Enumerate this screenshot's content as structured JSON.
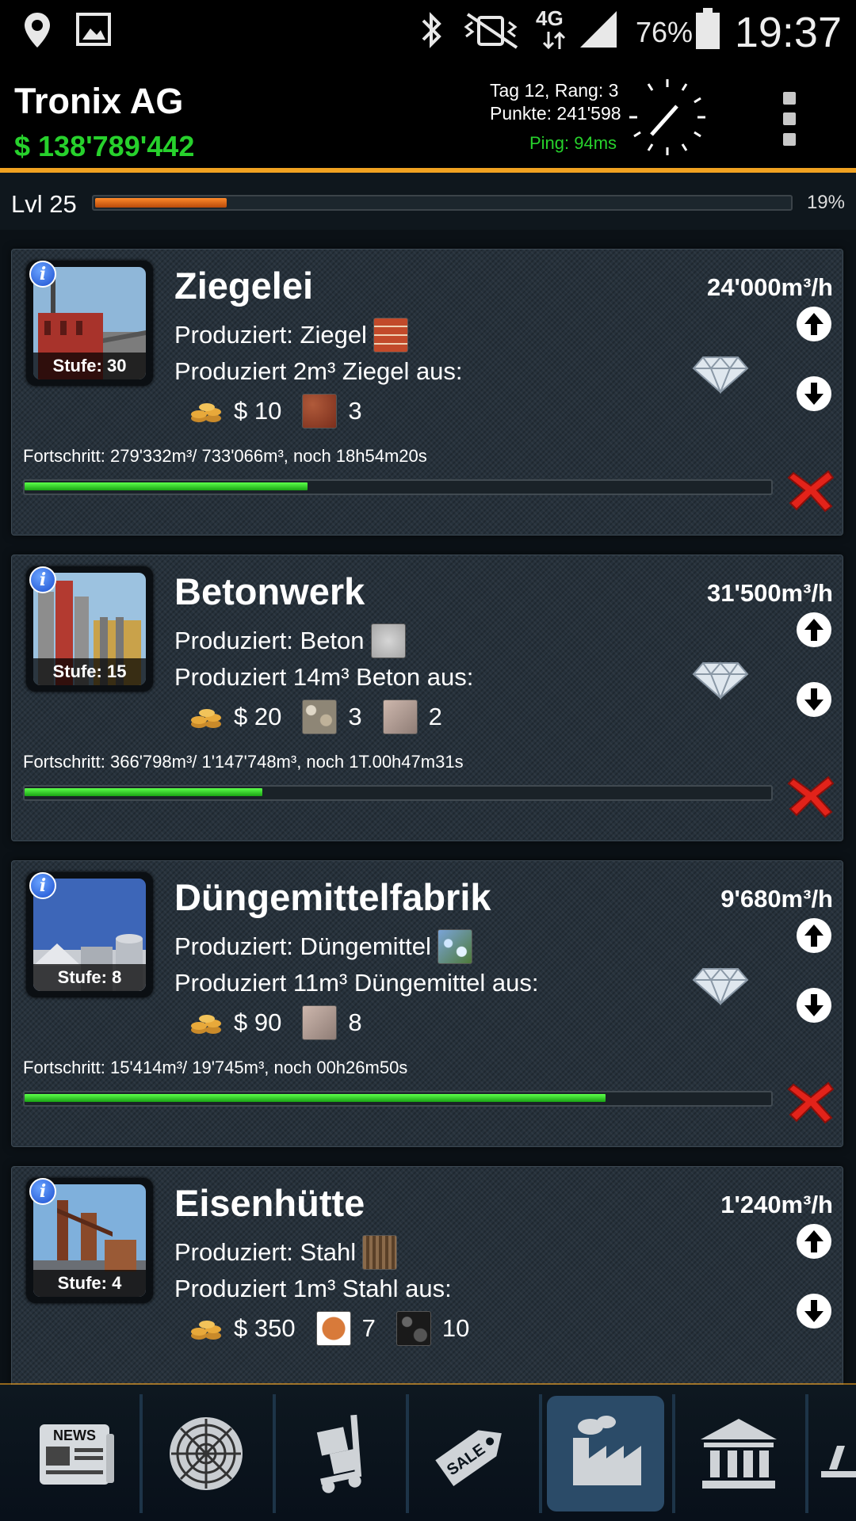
{
  "status_bar": {
    "network": "4G",
    "battery": "76%",
    "time": "19:37"
  },
  "header": {
    "company": "Tronix AG",
    "money": "$ 138'789'442",
    "day_rank": "Tag 12, Rang: 3",
    "points": "Punkte: 241'598",
    "ping": "Ping: 94ms"
  },
  "level": {
    "label": "Lvl 25",
    "percent_label": "19%",
    "fraction": 0.19
  },
  "factories": [
    {
      "name": "Ziegelei",
      "rate": "24'000m³/h",
      "stufe": "Stufe: 30",
      "produces": "Produziert: Ziegel",
      "recipe": "Produziert 2m³ Ziegel aus:",
      "cost": "$ 10",
      "inputs": [
        {
          "icon": "clay-icon",
          "qty": "3"
        }
      ],
      "progress_text": "Fortschritt: 279'332m³/ 733'066m³, noch 18h54m20s",
      "progress": 0.381
    },
    {
      "name": "Betonwerk",
      "rate": "31'500m³/h",
      "stufe": "Stufe: 15",
      "produces": "Produziert: Beton",
      "recipe": "Produziert 14m³ Beton aus:",
      "cost": "$ 20",
      "inputs": [
        {
          "icon": "gravel-icon",
          "qty": "3"
        },
        {
          "icon": "sand-icon",
          "qty": "2"
        }
      ],
      "progress_text": "Fortschritt: 366'798m³/ 1'147'748m³, noch 1T.00h47m31s",
      "progress": 0.32
    },
    {
      "name": "Düngemittelfabrik",
      "rate": "9'680m³/h",
      "stufe": "Stufe: 8",
      "produces": "Produziert: Düngemittel",
      "recipe": "Produziert 11m³ Düngemittel aus:",
      "cost": "$ 90",
      "inputs": [
        {
          "icon": "sand-icon",
          "qty": "8"
        }
      ],
      "progress_text": "Fortschritt: 15'414m³/ 19'745m³, noch 00h26m50s",
      "progress": 0.781
    },
    {
      "name": "Eisenhütte",
      "rate": "1'240m³/h",
      "stufe": "Stufe: 4",
      "produces": "Produziert: Stahl",
      "recipe": "Produziert 1m³ Stahl aus:",
      "cost": "$ 350",
      "inputs": [
        {
          "icon": "iron-ore-icon",
          "qty": "7"
        },
        {
          "icon": "coal-icon",
          "qty": "10"
        }
      ]
    }
  ],
  "nav": {
    "news_label": "NEWS",
    "sale_label": "SALE",
    "items": [
      "news-icon",
      "radar-icon",
      "trolley-icon",
      "sale-tag-icon",
      "factory-icon",
      "bank-icon",
      "more-icon"
    ],
    "active": "factory-icon"
  }
}
